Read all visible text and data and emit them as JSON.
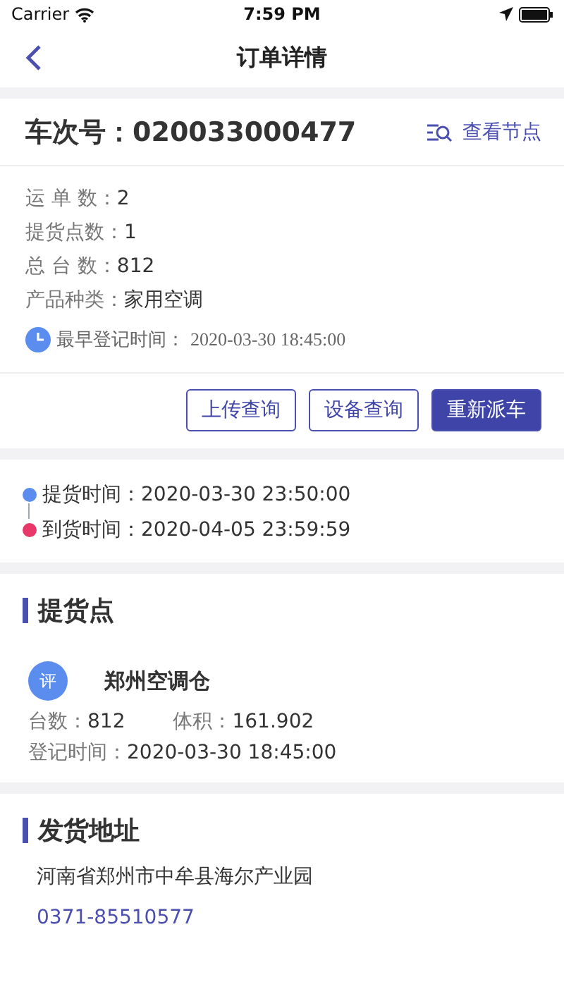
{
  "status_bar": {
    "carrier": "Carrier",
    "time": "7:59 PM"
  },
  "nav": {
    "title": "订单详情"
  },
  "order": {
    "trip_label": "车次号：",
    "trip_no": "020033000477",
    "nodes_link": "查看节点",
    "fields": [
      {
        "label": "运 单 数：",
        "value": "2"
      },
      {
        "label": "提货点数：",
        "value": "1"
      },
      {
        "label": "总 台 数：",
        "value": "812"
      },
      {
        "label": "产品种类：",
        "value": "家用空调"
      }
    ],
    "earliest": {
      "label": "最早登记时间：",
      "value": "2020-03-30 18:45:00"
    },
    "buttons": [
      {
        "label": "上传查询",
        "kind": "outline"
      },
      {
        "label": "设备查询",
        "kind": "outline"
      },
      {
        "label": "重新派车",
        "kind": "primary"
      }
    ]
  },
  "timeline": [
    {
      "label": "提货时间：",
      "value": "2020-03-30 23:50:00",
      "color": "#5b8def"
    },
    {
      "label": "到货时间：",
      "value": "2020-04-05 23:59:59",
      "color": "#e8386a"
    }
  ],
  "pickup": {
    "title": "提货点",
    "badge": "评",
    "name": "郑州空调仓",
    "count_label": "台数：",
    "count": "812",
    "volume_label": "体积：",
    "volume": "161.902",
    "time_label": "登记时间：",
    "time": "2020-03-30 18:45:00"
  },
  "address": {
    "title": "发货地址",
    "text": "河南省郑州市中牟县海尔产业园",
    "phone": "0371-85510577"
  }
}
